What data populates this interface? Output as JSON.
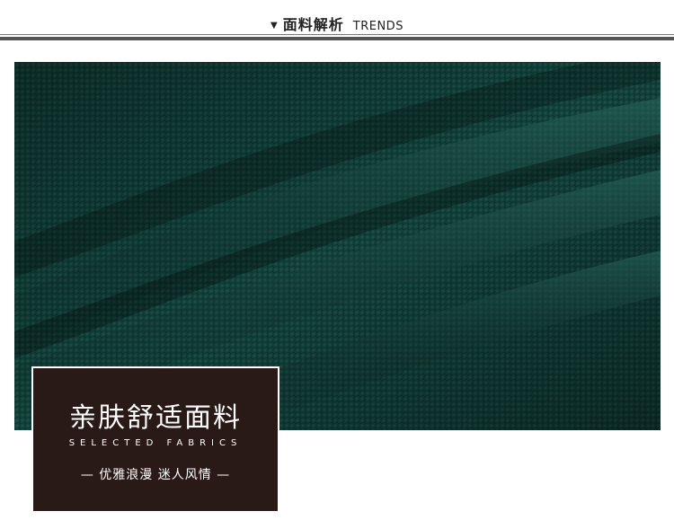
{
  "header": {
    "marker": "▼",
    "title_cn": "面料解析",
    "title_en": "TRENDS"
  },
  "photo": {
    "subject": "fabric-closeup",
    "base_color": "#0f3a34"
  },
  "label": {
    "title": "亲肤舒适面料",
    "subtitle": "SELECTED FABRICS",
    "tagline": "— 优雅浪漫 迷人风情 —"
  },
  "colors": {
    "label_bg": "#2a1a17",
    "fabric_dark": "#0c2f2b",
    "fabric_light": "#1f5a52"
  }
}
